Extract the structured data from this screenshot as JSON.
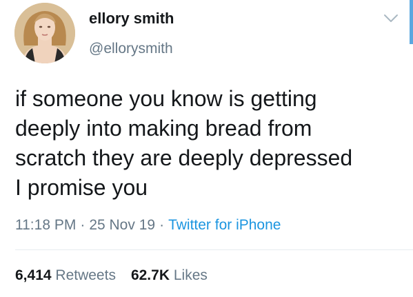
{
  "tweet": {
    "author": {
      "display_name": "ellory smith",
      "username": "@ellorysmith"
    },
    "text_lines": [
      "if someone you know is getting",
      "deeply into making bread from",
      "scratch they are deeply depressed",
      "I promise you"
    ],
    "time": "11:18 PM",
    "date": "25 Nov 19",
    "separator": "·",
    "source": "Twitter for iPhone",
    "stats": {
      "retweets_count": "6,414",
      "retweets_label": "Retweets",
      "likes_count": "62.7K",
      "likes_label": "Likes"
    }
  },
  "icons": {
    "menu": "chevron-down-icon"
  },
  "colors": {
    "text_primary": "#14171a",
    "text_secondary": "#657786",
    "link": "#1b95e0",
    "divider": "#e6ecf0"
  }
}
